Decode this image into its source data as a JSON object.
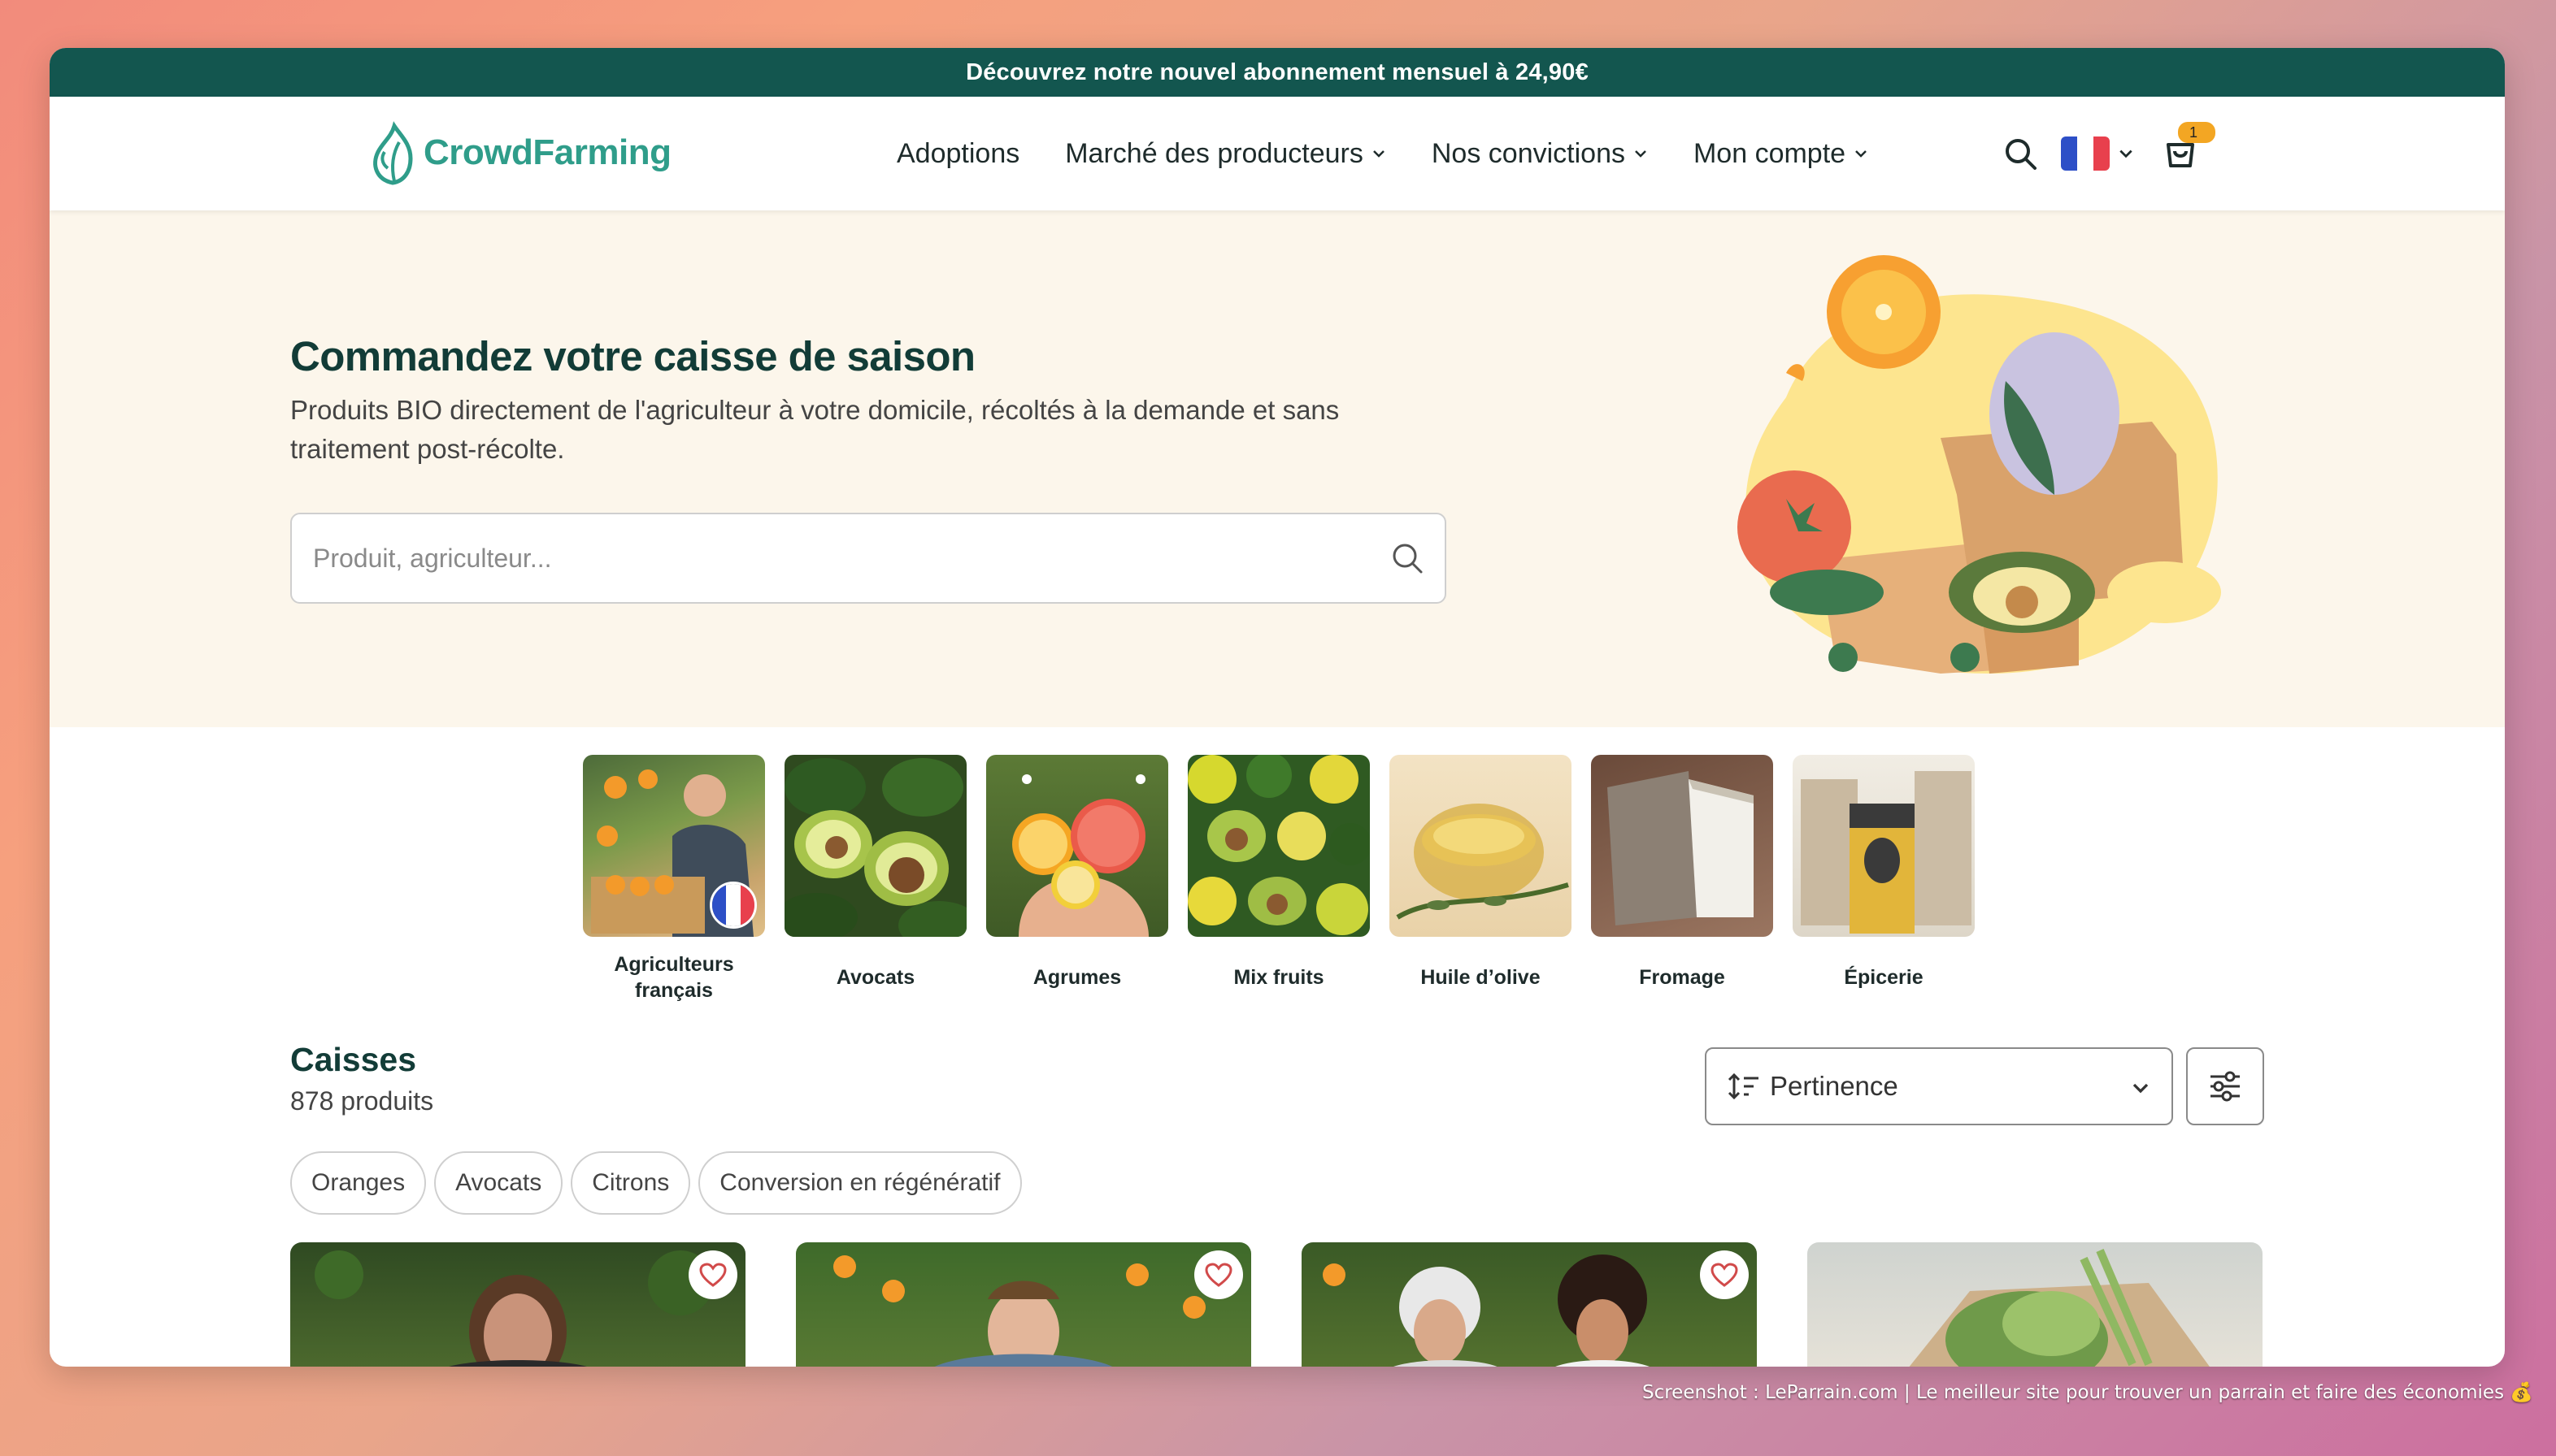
{
  "promo_banner": {
    "text": "Découvrez notre nouvel abonnement mensuel à 24,90€"
  },
  "header": {
    "logo_text": "CrowdFarming",
    "nav": [
      {
        "label": "Adoptions",
        "has_dropdown": false
      },
      {
        "label": "Marché des producteurs",
        "has_dropdown": true
      },
      {
        "label": "Nos convictions",
        "has_dropdown": true
      },
      {
        "label": "Mon compte",
        "has_dropdown": true
      }
    ],
    "icons": [
      "search-icon",
      "language-flag-fr",
      "chevron-down-icon",
      "cart-icon"
    ],
    "cart_count": "1"
  },
  "hero": {
    "title": "Commandez votre caisse de saison",
    "subtitle": "Produits BIO directement de l'agriculteur à votre domicile, récoltés à la demande et sans traitement post-récolte.",
    "search_placeholder": "Produit, agriculteur..."
  },
  "categories": [
    {
      "label": "Agriculteurs français",
      "image": "farmer-with-oranges"
    },
    {
      "label": "Avocats",
      "image": "avocados"
    },
    {
      "label": "Agrumes",
      "image": "citrus"
    },
    {
      "label": "Mix fruits",
      "image": "mixed-fruits"
    },
    {
      "label": "Huile d’olive",
      "image": "olive-oil"
    },
    {
      "label": "Fromage",
      "image": "cheese"
    },
    {
      "label": "Épicerie",
      "image": "grocery"
    }
  ],
  "section": {
    "title": "Caisses",
    "count": "878 produits",
    "sort_label": "Pertinence"
  },
  "chips": [
    "Oranges",
    "Avocats",
    "Citrons",
    "Conversion en régénératif"
  ],
  "products": [
    {
      "image": "farmer-woman-orchard",
      "favorite": true
    },
    {
      "image": "farmer-man-orange-tree",
      "favorite": true
    },
    {
      "image": "two-farmers",
      "favorite": true
    },
    {
      "image": "vegetable-box",
      "favorite": false
    }
  ],
  "watermark": "Screenshot : LeParrain.com | Le meilleur site pour trouver un parrain et faire des économies 💰",
  "colors": {
    "brand_dark": "#13564f",
    "brand_teal": "#2f9d8a",
    "hero_bg": "#fcf6eb",
    "title": "#123c37",
    "badge": "#f3a623"
  }
}
